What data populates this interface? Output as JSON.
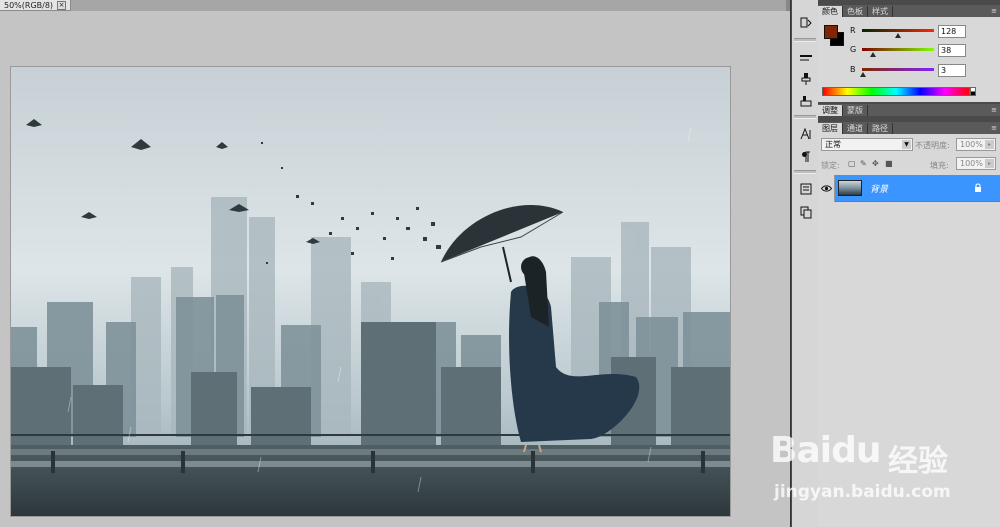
{
  "document": {
    "tab_title": "50%(RGB/8)",
    "tab_close_glyph": "×"
  },
  "color_panel": {
    "tabs": [
      "颜色",
      "色板",
      "样式"
    ],
    "foreground_color": "#802603",
    "background_color": "#000000",
    "channels": [
      {
        "label": "R",
        "value": "128",
        "fraction": 0.502
      },
      {
        "label": "G",
        "value": "38",
        "fraction": 0.149
      },
      {
        "label": "B",
        "value": "3",
        "fraction": 0.012
      }
    ]
  },
  "adjust_panel": {
    "tabs": [
      "调整",
      "蒙版"
    ]
  },
  "layers_panel": {
    "tabs": [
      "图层",
      "通道",
      "路径"
    ],
    "blend_mode": "正常",
    "opacity_label": "不透明度:",
    "opacity_value": "100%",
    "lock_label": "锁定:",
    "fill_label": "填充:",
    "fill_value": "100%",
    "layers": [
      {
        "name": "背景",
        "selected": true,
        "visible": true,
        "locked": true
      }
    ]
  },
  "tools": [
    "history-icon",
    "brush-presets-icon",
    "clone-source-icon",
    "tool-presets-icon",
    "character-icon",
    "paragraph-icon",
    "layer-comps-icon",
    "duplicate-icon"
  ],
  "watermark": {
    "brand": "Baidu",
    "brand_cn": "经验",
    "url": "jingyan.baidu.com"
  }
}
